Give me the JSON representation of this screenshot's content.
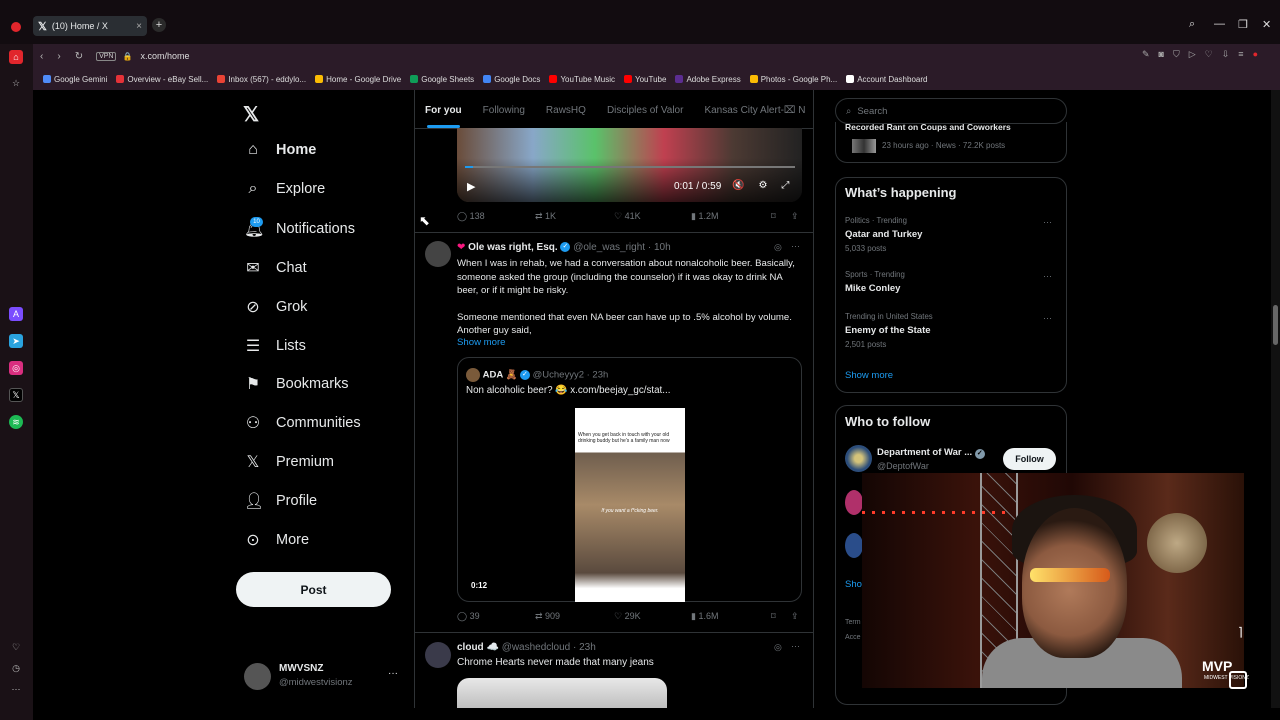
{
  "browser": {
    "tab_title": "(10) Home / X",
    "url": "x.com/home",
    "vpn_label": "VPN",
    "bookmarks": [
      {
        "label": "Google Gemini",
        "color": "#4f8cf7"
      },
      {
        "label": "Overview - eBay Sell...",
        "color": "#e53238"
      },
      {
        "label": "Inbox (567) - eddylo...",
        "color": "#ea4335"
      },
      {
        "label": "Home - Google Drive",
        "color": "#fbbc04"
      },
      {
        "label": "Google Sheets",
        "color": "#0f9d58"
      },
      {
        "label": "Google Docs",
        "color": "#4285f4"
      },
      {
        "label": "YouTube Music",
        "color": "#ff0000"
      },
      {
        "label": "YouTube",
        "color": "#ff0000"
      },
      {
        "label": "Adobe Express",
        "color": "#5c2d91"
      },
      {
        "label": "Photos - Google Ph...",
        "color": "#fbbc04"
      },
      {
        "label": "Account Dashboard",
        "color": "#ffffff"
      }
    ]
  },
  "nav": {
    "items": [
      {
        "label": "Home",
        "icon": "home-icon"
      },
      {
        "label": "Explore",
        "icon": "search-icon"
      },
      {
        "label": "Notifications",
        "icon": "bell-icon"
      },
      {
        "label": "Chat",
        "icon": "mail-icon"
      },
      {
        "label": "Grok",
        "icon": "grok-icon"
      },
      {
        "label": "Lists",
        "icon": "list-icon"
      },
      {
        "label": "Bookmarks",
        "icon": "bookmark-icon"
      },
      {
        "label": "Communities",
        "icon": "communities-icon"
      },
      {
        "label": "Premium",
        "icon": "x-logo-icon"
      },
      {
        "label": "Profile",
        "icon": "person-icon"
      },
      {
        "label": "More",
        "icon": "more-circle-icon"
      }
    ],
    "notifications_badge": "10",
    "post_label": "Post",
    "account_name": "MWVSNZ",
    "account_handle": "@midwestvisionz"
  },
  "feed": {
    "tabs": [
      "For you",
      "Following",
      "RawsHQ",
      "Disciples of Valor",
      "Kansas City Alert-⌧ N"
    ],
    "video1": {
      "time": "0:01 / 0:59",
      "replies": "138",
      "reposts": "1K",
      "likes": "41K",
      "views": "1.2M"
    },
    "tweet1": {
      "name": "Ole was right, Esq.",
      "handle": "@ole_was_right",
      "time": "· 10h",
      "para1": "When I was in rehab, we had a conversation about nonalcoholic beer. Basically, someone asked the group (including the counselor) if it was okay to drink NA beer, or if it might be risky.",
      "para2": "Someone mentioned that even NA beer can have up to .5% alcohol by volume. Another guy said,",
      "show_more": "Show more",
      "quote_name": "ADA 🧸",
      "quote_handle": "@Ucheyyy2 · 23h",
      "quote_text": "Non alcoholic beer? 😂 x.com/beejay_gc/stat...",
      "quote_video_top": "When you get back in touch with your old drinking buddy but he's a family man now",
      "quote_video_sub": "If you want a f*cking beer.",
      "quote_duration": "0:12",
      "replies": "39",
      "reposts": "909",
      "likes": "29K",
      "views": "1.6M"
    },
    "tweet2": {
      "name": "cloud ☁️",
      "handle": "@washedcloud",
      "time": "· 23h",
      "text": "Chrome Hearts never made that many jeans"
    }
  },
  "sidebar": {
    "search_placeholder": "Search",
    "news_title": "Recorded Rant on Coups and Coworkers",
    "news_meta": "23 hours ago · News · 72.2K posts",
    "happening_title": "What’s happening",
    "trends": [
      {
        "meta": "Politics · Trending",
        "name": "Qatar and Turkey",
        "posts": "5,033 posts"
      },
      {
        "meta": "Sports · Trending",
        "name": "Mike Conley",
        "posts": ""
      },
      {
        "meta": "Trending in United States",
        "name": "Enemy of the State",
        "posts": "2,501 posts"
      }
    ],
    "show_more": "Show more",
    "who_to_follow_title": "Who to follow",
    "follow_name": "Department of War ...",
    "follow_handle": "@DeptofWar",
    "follow_label": "Follow",
    "follow_show_more": "Show",
    "footer1": "Term",
    "footer2": "Acce"
  },
  "overlay": {
    "brand": "MVP",
    "brand_sub": "MIDWEST VISIONZ"
  }
}
